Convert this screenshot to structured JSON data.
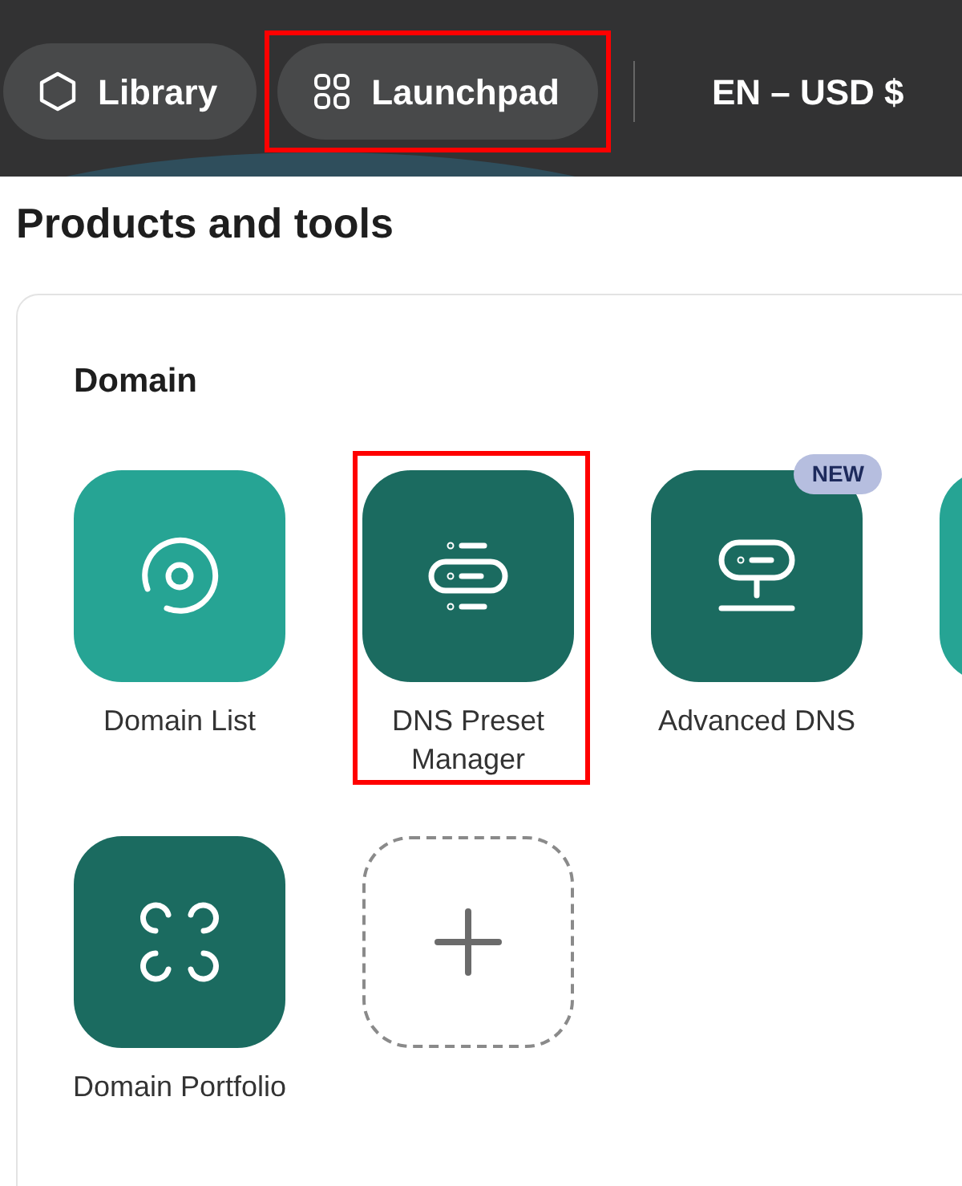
{
  "top_bar": {
    "nav": [
      {
        "label": "Library",
        "highlighted": false
      },
      {
        "label": "Launchpad",
        "highlighted": true
      }
    ],
    "locale": "EN – USD $"
  },
  "page_title": "Products and tools",
  "section": {
    "title": "Domain",
    "tiles": [
      {
        "kind": "app",
        "label": "Domain List",
        "color": "#26a494",
        "highlighted": false
      },
      {
        "kind": "app",
        "label": "DNS Preset Manager",
        "color": "#1b6b60",
        "highlighted": true
      },
      {
        "kind": "app",
        "label": "Advanced DNS",
        "color": "#1b6b60",
        "badge": "NEW",
        "highlighted": false
      },
      {
        "kind": "app",
        "color": "#26a494",
        "highlighted": false
      },
      {
        "kind": "app",
        "label": "Domain Portfolio",
        "color": "#1b6b60",
        "highlighted": false
      },
      {
        "kind": "add",
        "highlighted": false
      }
    ]
  }
}
